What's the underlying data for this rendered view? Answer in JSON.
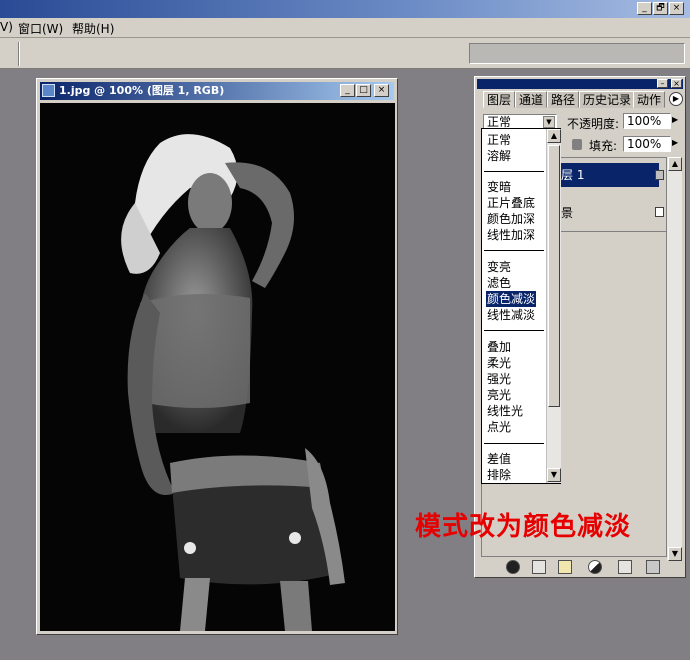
{
  "app": {
    "menu": [
      "V)",
      "窗口(W)",
      "帮助(H)"
    ],
    "window_buttons": [
      "_",
      "🗗",
      "×"
    ]
  },
  "document": {
    "title": "1.jpg @ 100% (图层 1, RGB)",
    "window_buttons": [
      "_",
      "□",
      "×"
    ]
  },
  "layers_panel": {
    "tabs": [
      "图层",
      "通道",
      "路径",
      "历史记录",
      "动作"
    ],
    "blend_mode": "正常",
    "opacity_label": "不透明度:",
    "opacity_value": "100%",
    "fill_label": "填充:",
    "fill_value": "100%",
    "layers": [
      {
        "name": "层 1",
        "selected": true
      },
      {
        "name": "景",
        "selected": false
      }
    ]
  },
  "blend_dropdown": {
    "groups": [
      [
        "正常",
        "溶解"
      ],
      [
        "变暗",
        "正片叠底",
        "颜色加深",
        "线性加深"
      ],
      [
        "变亮",
        "滤色",
        "颜色减淡",
        "线性减淡"
      ],
      [
        "叠加",
        "柔光",
        "强光",
        "亮光",
        "线性光",
        "点光"
      ],
      [
        "差值",
        "排除"
      ]
    ],
    "selected": "颜色减淡"
  },
  "caption": "模式改为颜色减淡",
  "colors": {
    "desktop": "#817f84",
    "title_blue": "#0a246a",
    "caption_red": "#e60000"
  }
}
